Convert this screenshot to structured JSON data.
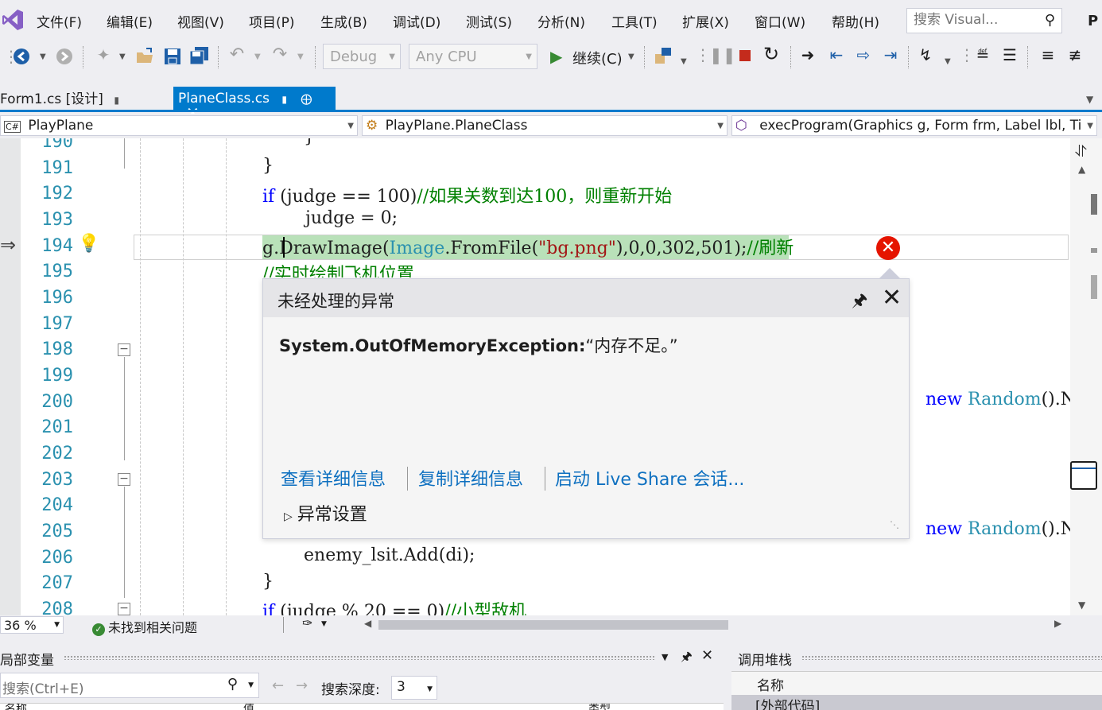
{
  "menu": {
    "items": [
      "文件(F)",
      "编辑(E)",
      "视图(V)",
      "项目(P)",
      "生成(B)",
      "调试(D)",
      "测试(S)",
      "分析(N)",
      "工具(T)",
      "扩展(X)",
      "窗口(W)",
      "帮助(H)"
    ],
    "search_placeholder": "搜索 Visual...",
    "overflow_letter": "P"
  },
  "toolbar": {
    "config": "Debug",
    "platform": "Any CPU",
    "continue_label": "继续(C)"
  },
  "tabs": {
    "form1": "Form1.cs [设计]",
    "active": "PlaneClass.cs"
  },
  "navbar": {
    "project": "PlayPlane",
    "class": "PlayPlane.PlaneClass",
    "member": "execProgram(Graphics g, Form frm, Label lbl, Ti"
  },
  "editor": {
    "line_numbers": [
      "190",
      "191",
      "192",
      "193",
      "194",
      "195",
      "196",
      "197",
      "198",
      "199",
      "200",
      "201",
      "202",
      "203",
      "204",
      "205",
      "206",
      "207",
      "208"
    ],
    "lines": {
      "l190": "}",
      "l191": "}",
      "l192_kw": "if",
      "l192_code": " (judge == 100)",
      "l192_comment": "//如果关数到达100，则重新开始",
      "l193": "judge = 0;",
      "l194_code_a": "g.DrawImage(",
      "l194_type": "Image",
      "l194_code_b": ".FromFile(",
      "l194_str": "\"bg.png\"",
      "l194_code_c": "),0,0,302,501);",
      "l194_comment": "//刷新",
      "l195_comment": "//实时绘制飞机位置",
      "l200_kw": "new",
      "l200_type": "Random",
      "l200_code": "().N",
      "l205_kw": "new",
      "l205_type": "Random",
      "l205_code": "().N",
      "l206": "enemy_lsit.Add(di);",
      "l207": "}",
      "l208_kw": "if",
      "l208_code": " (judge % 20 == 0)",
      "l208_comment": "//小型敌机"
    }
  },
  "exception": {
    "title": "未经处理的异常",
    "type": "System.OutOfMemoryException:",
    "message": "“内存不足。”",
    "link_details": "查看详细信息",
    "link_copy": "复制详细信息",
    "link_liveshare": "启动 Live Share 会话...",
    "settings": "异常设置"
  },
  "status": {
    "zoom": "36 %",
    "issues": "未找到相关问题"
  },
  "locals": {
    "title": "局部变量",
    "search_placeholder": "搜索(Ctrl+E)",
    "depth_label": "搜索深度:",
    "depth_value": "3",
    "col_name": "名称",
    "col_value": "值",
    "col_type": "类型"
  },
  "callstack": {
    "title": "调用堆栈",
    "col_name": "名称",
    "row1": "[外部代码]"
  },
  "colors": {
    "accent": "#007acc",
    "keyword": "#0000ff",
    "comment": "#008000",
    "type": "#2b91af",
    "line_number": "#2b91af",
    "exec_highlight": "#b9e1b9",
    "error": "#e51400",
    "link": "#0e70c0"
  }
}
